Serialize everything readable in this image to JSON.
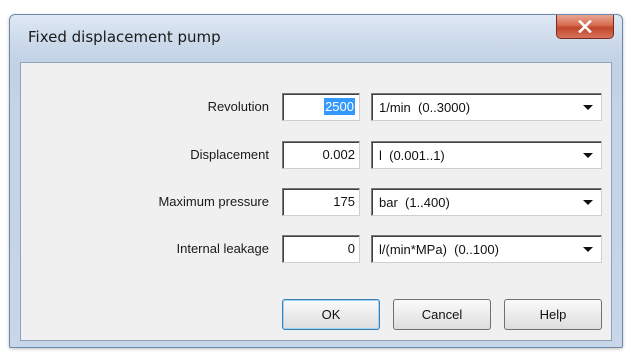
{
  "window": {
    "title": "Fixed displacement pump",
    "close_icon": "close-icon"
  },
  "fields": [
    {
      "label": "Revolution",
      "value": "2500",
      "value_selected": true,
      "unit": "1/min  (0..3000)"
    },
    {
      "label": "Displacement",
      "value": "0.002",
      "value_selected": false,
      "unit": "l  (0.001..1)"
    },
    {
      "label": "Maximum pressure",
      "value": "175",
      "value_selected": false,
      "unit": "bar  (1..400)"
    },
    {
      "label": "Internal leakage",
      "value": "0",
      "value_selected": false,
      "unit": "l/(min*MPa)  (0..100)"
    }
  ],
  "buttons": {
    "ok": "OK",
    "cancel": "Cancel",
    "help": "Help"
  },
  "colors": {
    "selection": "#3399ff",
    "close_button": "#c2452b",
    "default_button_border": "#3c7fb1"
  }
}
